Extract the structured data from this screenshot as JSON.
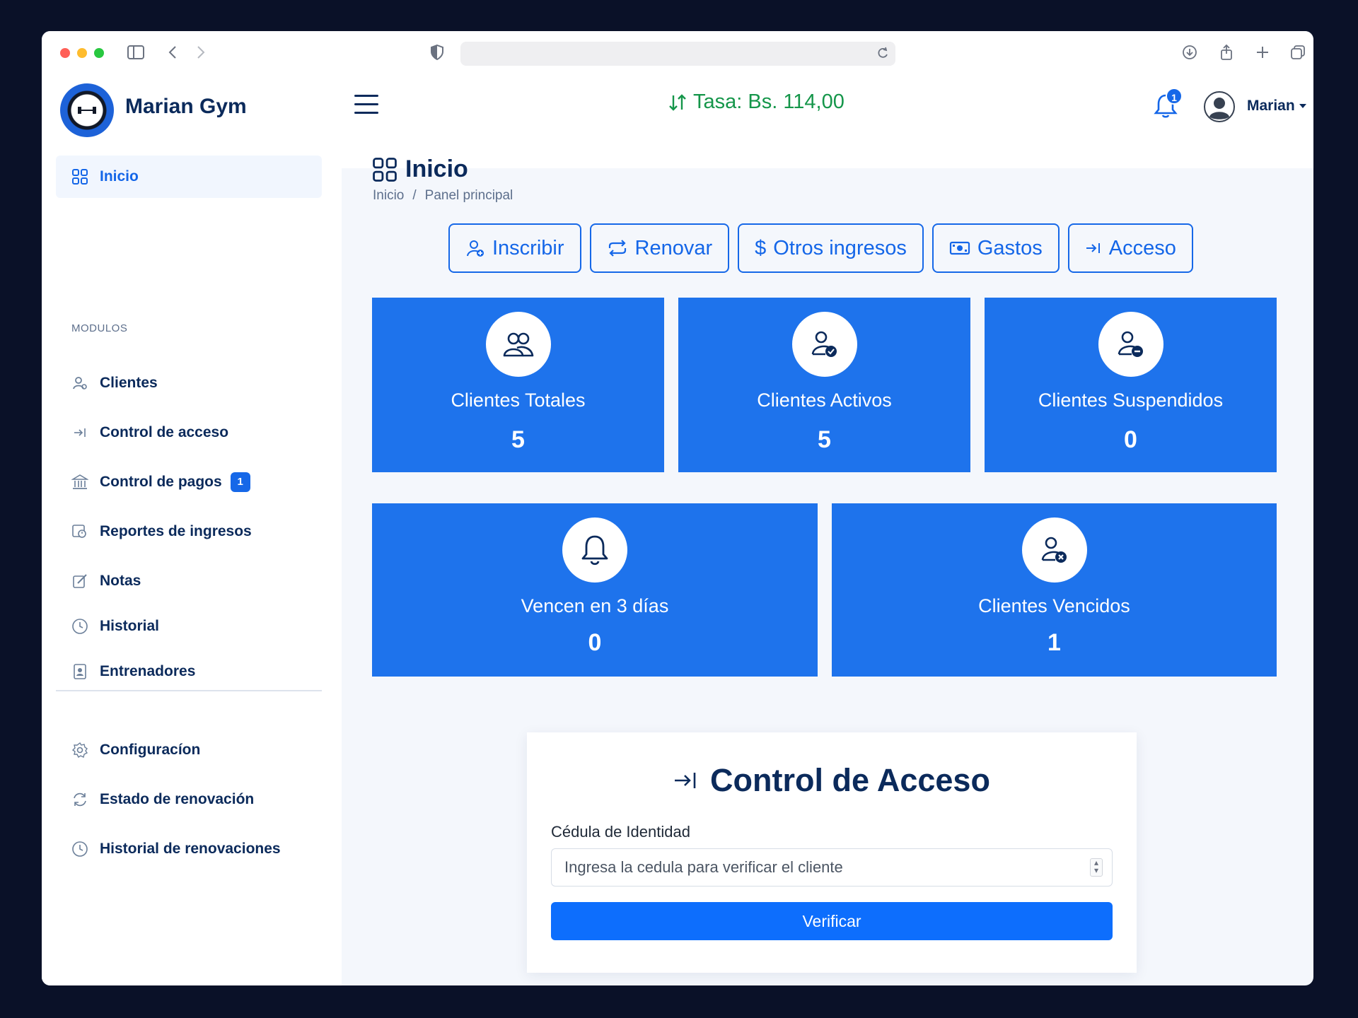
{
  "browser": {
    "url_text": ""
  },
  "header": {
    "brand": "Marian Gym",
    "rate": "Tasa: Bs. 114,00",
    "notifications_count": "1",
    "user_name": "Marian"
  },
  "sidebar": {
    "section_label": "MODULOS",
    "items": [
      {
        "label": "Inicio",
        "icon": "grid-icon"
      },
      {
        "label": "Clientes",
        "icon": "users-icon"
      },
      {
        "label": "Control de acceso",
        "icon": "login-arrow-icon"
      },
      {
        "label": "Control de pagos",
        "icon": "bank-icon",
        "badge": "1"
      },
      {
        "label": "Reportes de ingresos",
        "icon": "report-icon"
      },
      {
        "label": "Notas",
        "icon": "edit-icon"
      },
      {
        "label": "Historial",
        "icon": "clock-icon"
      },
      {
        "label": "Entrenadores",
        "icon": "id-badge-icon"
      },
      {
        "label": "Configuracíon",
        "icon": "gear-icon"
      },
      {
        "label": "Estado de renovación",
        "icon": "refresh-icon"
      },
      {
        "label": "Historial de renovaciones",
        "icon": "clock-icon"
      }
    ]
  },
  "page": {
    "title": "Inicio",
    "breadcrumb": [
      "Inicio",
      "/",
      "Panel principal"
    ]
  },
  "actions": [
    {
      "label": "Inscribir",
      "icon": "user-plus-icon"
    },
    {
      "label": "Renovar",
      "icon": "repeat-icon"
    },
    {
      "label": "Otros ingresos",
      "icon": "dollar-icon"
    },
    {
      "label": "Gastos",
      "icon": "cash-icon"
    },
    {
      "label": "Acceso",
      "icon": "login-arrow-icon"
    }
  ],
  "stats": [
    {
      "label": "Clientes Totales",
      "value": "5",
      "icon": "users-icon"
    },
    {
      "label": "Clientes Activos",
      "value": "5",
      "icon": "user-check-icon"
    },
    {
      "label": "Clientes Suspendidos",
      "value": "0",
      "icon": "user-minus-icon"
    },
    {
      "label": "Vencen en 3 días",
      "value": "0",
      "icon": "bell-icon"
    },
    {
      "label": "Clientes Vencidos",
      "value": "1",
      "icon": "user-x-icon"
    }
  ],
  "access_control": {
    "title": "Control de Acceso",
    "field_label": "Cédula de Identidad",
    "placeholder": "Ingresa la cedula para verificar el cliente",
    "value": "",
    "button_label": "Verificar"
  },
  "colors": {
    "primary": "#1e73ec",
    "accent_text": "#1466e8",
    "navy": "#0b2a5b",
    "rate_green": "#15964a",
    "page_bg": "#0a1128"
  }
}
